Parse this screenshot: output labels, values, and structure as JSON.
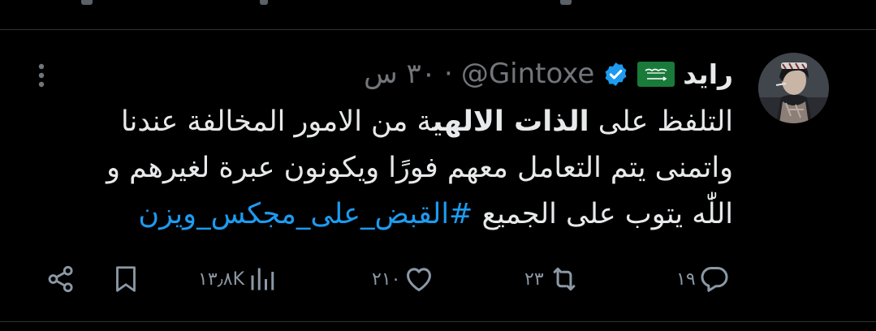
{
  "tweet": {
    "display_name": "رايد",
    "handle": "@Gintoxe",
    "separator": "·",
    "time": "٣٠ س",
    "flag_icon": "saudi-flag-icon",
    "verified_icon": "verified-badge-icon",
    "text": {
      "line1_start": "التلفظ على ",
      "line1_bold": "الذات الالهي",
      "line1_end": "ة من الامور المخالفة عندنا",
      "line2": "واتمنى يتم التعامل معهم فورًا ويكونون عبرة لغيرهم و",
      "line3_start": "اللّٰه يتوب على الجميع ",
      "hashtag": "#القبض_على_مجكس_ويزن"
    }
  },
  "actions": {
    "replies": {
      "count": "١٩",
      "icon": "reply-icon"
    },
    "reposts": {
      "count": "٢٣",
      "icon": "repost-icon"
    },
    "likes": {
      "count": "٢١٠",
      "icon": "like-icon"
    },
    "views": {
      "count": "١٣٫٨K",
      "icon": "views-icon"
    },
    "bookmark": {
      "icon": "bookmark-icon"
    },
    "share": {
      "icon": "share-icon"
    }
  },
  "colors": {
    "background": "#000000",
    "text": "#e7e9ea",
    "secondary": "#71767b",
    "accent": "#1d9bf0",
    "divider": "#2f3336"
  }
}
